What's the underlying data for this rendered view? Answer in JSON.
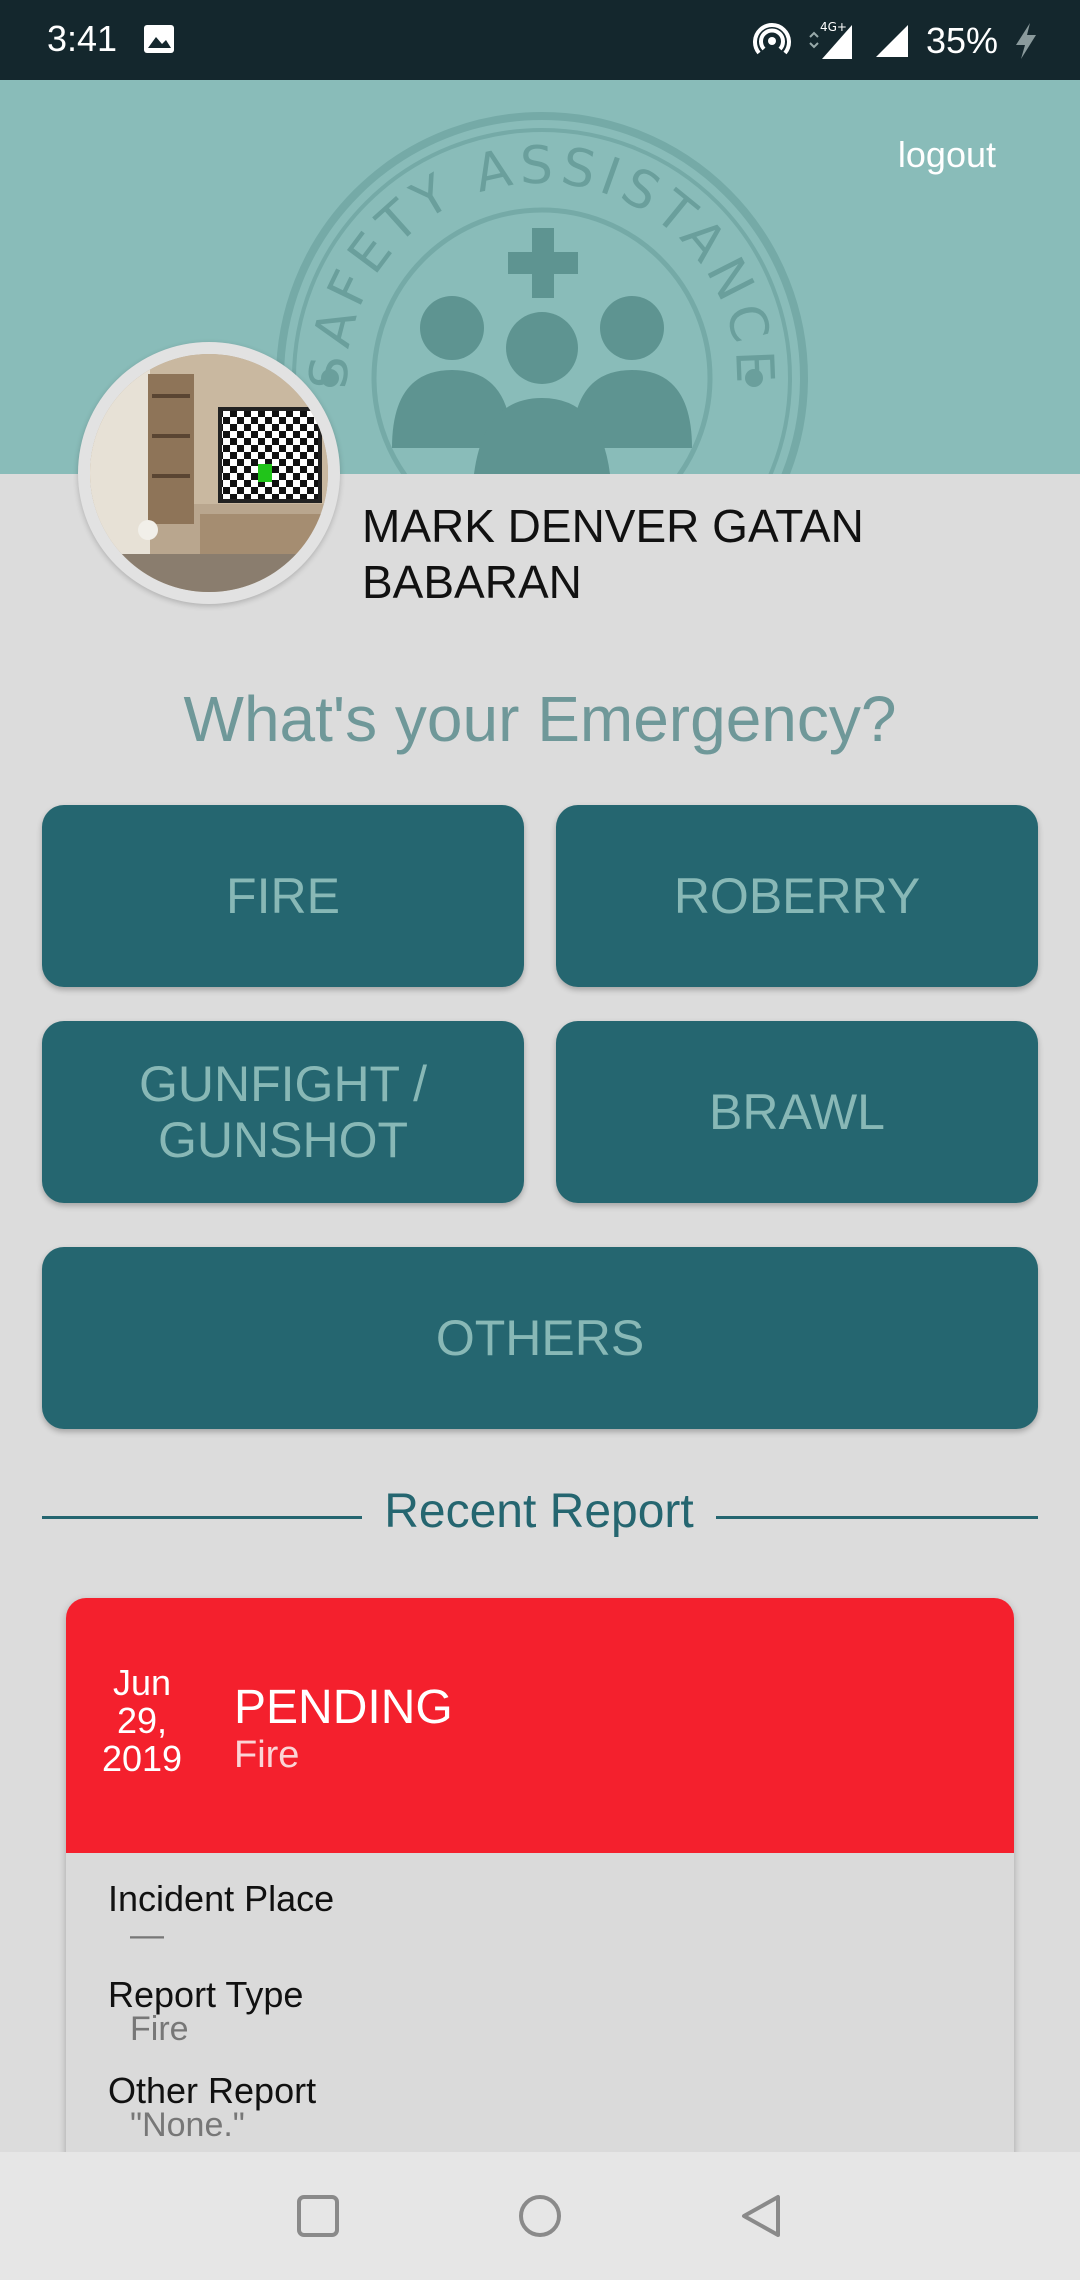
{
  "status_bar": {
    "time": "3:41",
    "network": "4G+",
    "battery": "35%"
  },
  "header": {
    "logout_label": "logout",
    "seal_text": "SAFETY ASSISTANCE"
  },
  "profile": {
    "name_line1": "MARK DENVER GATAN",
    "name_line2": "BABARAN"
  },
  "question": "What's your Emergency?",
  "buttons": {
    "fire": "FIRE",
    "robbery": "ROBERRY",
    "gunfight_line1": "GUNFIGHT /",
    "gunfight_line2": "GUNSHOT",
    "brawl": "BRAWL",
    "others": "OTHERS"
  },
  "recent": {
    "title": "Recent Report",
    "date_month": "Jun",
    "date_day": "29,",
    "date_year": "2019",
    "status": "PENDING",
    "type": "Fire",
    "head_color": "#f4202d",
    "fields": {
      "incident_place_label": "Incident Place",
      "incident_place_value": "—",
      "report_type_label": "Report Type",
      "report_type_value": "Fire",
      "other_report_label": "Other Report",
      "other_report_value": "\"None.\""
    }
  },
  "colors": {
    "header_bg": "#89bcb9",
    "button_bg": "#256670",
    "button_text": "#88b8b6"
  }
}
